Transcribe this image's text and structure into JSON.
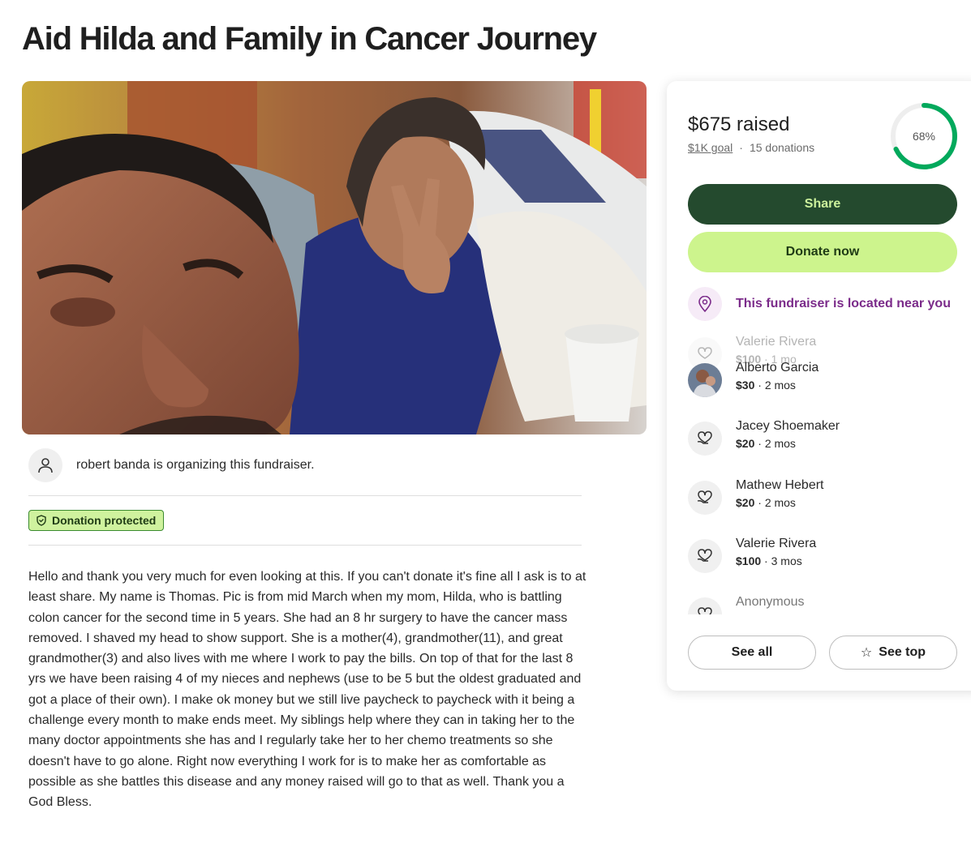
{
  "page": {
    "title": "Aid Hilda and Family in Cancer Journey"
  },
  "organizer": {
    "text": "robert banda is organizing this fundraiser."
  },
  "badge": {
    "label": "Donation protected"
  },
  "story": "Hello and thank you very much for even looking at this. If you can't donate it's fine all I ask is to at least share. My name is Thomas. Pic is from mid March when my mom, Hilda, who is battling colon cancer for the second time in 5 years. She had an 8 hr surgery to have the cancer mass removed. I shaved my head to show support. She is a mother(4), grandmother(11), and great grandmother(3) and also lives with me where I work to pay the bills. On top of that for the last 8 yrs we have been raising 4 of my nieces and nephews (use to be 5 but the oldest graduated and got a place of their own). I make ok money but we still live paycheck to paycheck with it being a challenge every month to make ends meet. My siblings help where they can in taking her to the many doctor appointments she has and I regularly take her to her chemo treatments so she doesn't have to go alone. Right now everything I work for is to make her as comfortable as possible as she battles this disease and any money raised will go to that as well. Thank you a God Bless.",
  "progress": {
    "raised": "$675 raised",
    "goal": "$1K goal",
    "separator": "·",
    "donations": "15 donations",
    "percent_label": "68%",
    "fraction": 0.68,
    "ring_color": "#02a95c"
  },
  "actions": {
    "share": "Share",
    "donate": "Donate now",
    "see_all": "See all",
    "see_top": "See top",
    "star": "☆"
  },
  "nearby": {
    "text": "This fundraiser is located near you"
  },
  "donors": [
    {
      "name": "Valerie Rivera",
      "amount": "$100",
      "time": "1 mo"
    },
    {
      "name": "Alberto Garcia",
      "amount": "$30",
      "time": "2 mos"
    },
    {
      "name": "Jacey Shoemaker",
      "amount": "$20",
      "time": "2 mos"
    },
    {
      "name": "Mathew Hebert",
      "amount": "$20",
      "time": "2 mos"
    },
    {
      "name": "Valerie Rivera",
      "amount": "$100",
      "time": "3 mos"
    },
    {
      "name": "Anonymous",
      "amount": "",
      "time": ""
    }
  ],
  "meta_sep": " · ",
  "colors": {
    "share_bg": "#244a2e",
    "donate_bg": "#cdf48d",
    "nearby_text": "#7b2b8a",
    "badge_bg": "#cff29e"
  }
}
